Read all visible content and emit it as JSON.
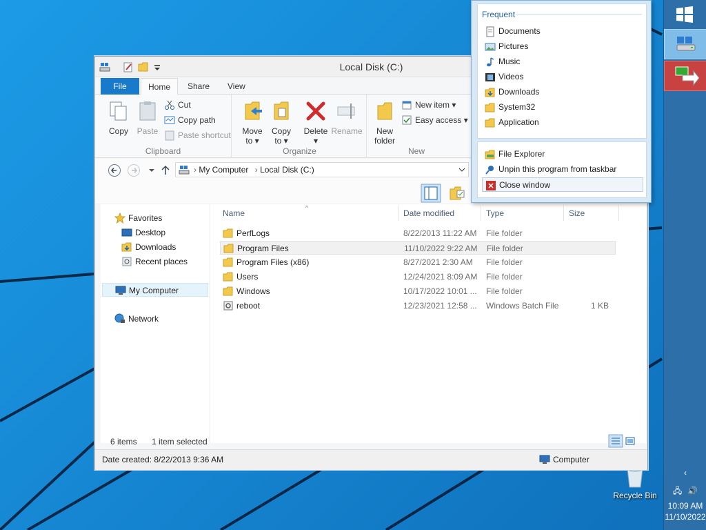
{
  "window": {
    "title": "Local Disk (C:)",
    "tabs": [
      "File",
      "Home",
      "Share",
      "View"
    ]
  },
  "ribbon": {
    "clipboard": {
      "copy": "Copy",
      "paste": "Paste",
      "cut": "Cut",
      "copy_path": "Copy path",
      "paste_shortcut": "Paste shortcut",
      "label": "Clipboard"
    },
    "organize": {
      "move_to_line1": "Move",
      "move_to_line2": "to ▾",
      "copy_to_line1": "Copy",
      "copy_to_line2": "to ▾",
      "delete_line1": "Delete",
      "delete_line2": "▾",
      "rename": "Rename",
      "label": "Organize"
    },
    "new": {
      "new_folder_line1": "New",
      "new_folder_line2": "folder",
      "new_item": "New item ▾",
      "easy_access": "Easy access ▾",
      "label": "New"
    }
  },
  "address": {
    "crumb1": "My Computer",
    "crumb2": "Local Disk (C:)"
  },
  "navpane": {
    "favorites": "Favorites",
    "desktop": "Desktop",
    "downloads": "Downloads",
    "recent_places": "Recent places",
    "my_computer": "My Computer",
    "network": "Network"
  },
  "columns": {
    "name": "Name",
    "date_modified": "Date modified",
    "type": "Type",
    "size": "Size"
  },
  "files": [
    {
      "name": "PerfLogs",
      "date": "8/22/2013 11:22 AM",
      "type": "File folder",
      "size": ""
    },
    {
      "name": "Program Files",
      "date": "11/10/2022 9:22 AM",
      "type": "File folder",
      "size": ""
    },
    {
      "name": "Program Files (x86)",
      "date": "8/27/2021 2:30 AM",
      "type": "File folder",
      "size": ""
    },
    {
      "name": "Users",
      "date": "12/24/2021 8:09 AM",
      "type": "File folder",
      "size": ""
    },
    {
      "name": "Windows",
      "date": "10/17/2022 10:01 ...",
      "type": "File folder",
      "size": ""
    },
    {
      "name": "reboot",
      "date": "12/23/2021 12:58 ...",
      "type": "Windows Batch File",
      "size": "1 KB"
    }
  ],
  "status": {
    "items": "6 items",
    "selected": "1 item selected",
    "date_created": "Date created: 8/22/2013 9:36 AM",
    "location": "Computer"
  },
  "jumplist": {
    "frequent_header": "Frequent",
    "frequent": [
      "Documents",
      "Pictures",
      "Music",
      "Videos",
      "Downloads",
      "System32",
      "Application"
    ],
    "tasks": [
      "File Explorer",
      "Unpin this program from taskbar",
      "Close window"
    ]
  },
  "desktop": {
    "recycle_bin": "Recycle Bin"
  },
  "tray": {
    "time": "10:09 AM",
    "date": "11/10/2022"
  }
}
